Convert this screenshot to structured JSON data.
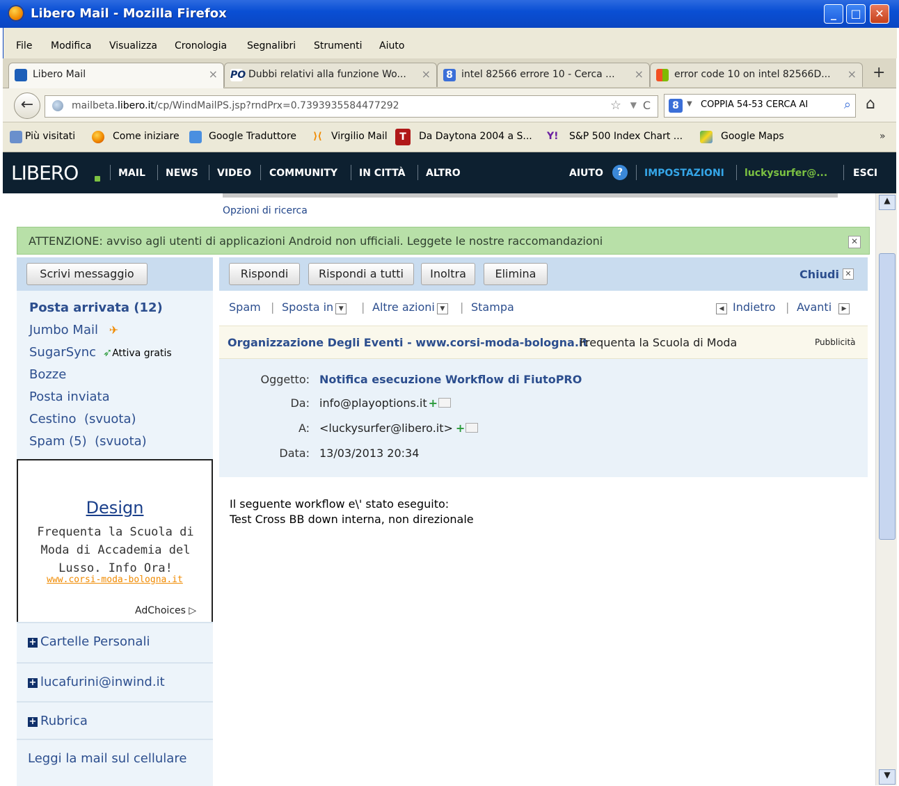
{
  "window": {
    "title": "Libero Mail - Mozilla Firefox"
  },
  "menubar": [
    "File",
    "Modifica",
    "Visualizza",
    "Cronologia",
    "Segnalibri",
    "Strumenti",
    "Aiuto"
  ],
  "tabs": [
    {
      "label": "Libero Mail",
      "close": "×"
    },
    {
      "label": "Dubbi relativi alla funzione Wo...",
      "close": "×"
    },
    {
      "label": "intel 82566 errore 10 - Cerca ...",
      "close": "×"
    },
    {
      "label": "error code 10 on intel 82566D...",
      "close": "×"
    }
  ],
  "new_tab": "+",
  "navbar": {
    "url_prefix": "mailbeta.",
    "url_domain": "libero.it",
    "url_path": "/cp/WindMailPS.jsp?rndPrx=0.7393935584477292",
    "search_value": "COPPIA 54-53 CERCA AI"
  },
  "bookmarks": [
    "Più visitati",
    "Come iniziare",
    "Google Traduttore",
    "Virgilio Mail",
    "Da Daytona 2004 a S...",
    "S&P 500 Index Chart ...",
    "Google Maps"
  ],
  "bookmarks_more": "»",
  "libero": {
    "logo": "LIBERO",
    "nav": [
      "MAIL",
      "NEWS",
      "VIDEO",
      "COMMUNITY",
      "IN CITTÀ",
      "ALTRO"
    ],
    "aiuto": "AIUTO",
    "impostazioni": "IMPOSTAZIONI",
    "user": "luckysurfer@...",
    "esci": "ESCI"
  },
  "search_options": "Opzioni di ricerca",
  "alert": "ATTENZIONE: avviso agli utenti di applicazioni Android non ufficiali. Leggete le nostre raccomandazioni",
  "left": {
    "compose": "Scrivi messaggio",
    "inbox": "Posta arrivata (12)",
    "jumbo": "Jumbo Mail",
    "sugarsync": "SugarSync",
    "attiva": "Attiva gratis",
    "bozze": "Bozze",
    "inviata": "Posta inviata",
    "cestino": "Cestino",
    "svuota": "(svuota)",
    "spam": "Spam (5)",
    "ad": {
      "title": "Design",
      "text": "Frequenta la Scuola di Moda di Accademia del Lusso. Info Ora!",
      "url": "www.corsi-moda-bologna.it",
      "adchoices": "AdChoices"
    },
    "cartelle": "Cartelle Personali",
    "inwind": "lucafurini@inwind.it",
    "rubrica": "Rubrica",
    "cellulare": "Leggi la mail sul cellulare"
  },
  "toolbar": {
    "rispondi": "Rispondi",
    "rispondi_tutti": "Rispondi a tutti",
    "inoltra": "Inoltra",
    "elimina": "Elimina",
    "chiudi": "Chiudi"
  },
  "actions": {
    "spam": "Spam",
    "sposta": "Sposta in",
    "altre": "Altre azioni",
    "stampa": "Stampa",
    "indietro": "Indietro",
    "avanti": "Avanti"
  },
  "adrow": {
    "link": "Organizzazione Degli Eventi - www.corsi-moda-bologna.it",
    "text": "Frequenta la Scuola di Moda",
    "label": "Pubblicità"
  },
  "message": {
    "oggetto_label": "Oggetto:",
    "oggetto": "Notifica esecuzione Workflow di FiutoPRO",
    "da_label": "Da:",
    "da": "info@playoptions.it",
    "a_label": "A:",
    "a": "<luckysurfer@libero.it>",
    "data_label": "Data:",
    "data": "13/03/2013 20:34",
    "body_line1": "Il seguente workflow e\\' stato eseguito:",
    "body_line2": "Test Cross BB down interna, non direzionale"
  }
}
